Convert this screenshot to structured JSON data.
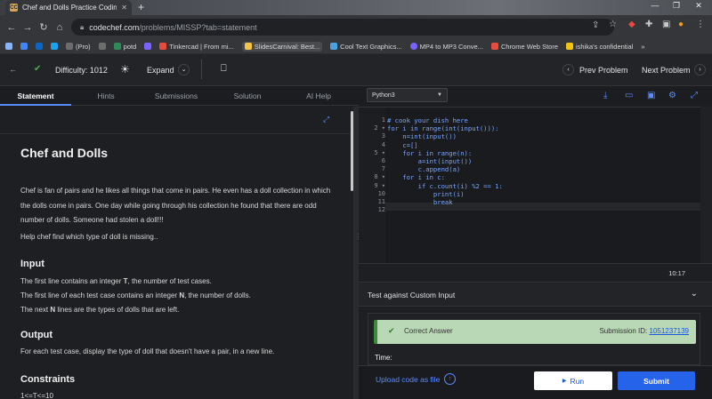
{
  "browser": {
    "tab_title": "Chef and Dolls Practice Coding P",
    "tab_favicon": "CC",
    "url_host": "codechef.com",
    "url_path": "/problems/MISSP?tab=statement",
    "bookmarks": [
      {
        "label": "(Pro)",
        "color": "#6d6d6d"
      },
      {
        "label": "potd",
        "color": "#2e8b57"
      },
      {
        "label": "Tinkercad | From mi...",
        "color": "#e84b3c"
      },
      {
        "label": "SlidesCarnival: Best...",
        "color": "#f4c542"
      },
      {
        "label": "Cool Text Graphics...",
        "color": "#4aa3df"
      },
      {
        "label": "MP4 to MP3 Conve...",
        "color": "#7b61ff"
      },
      {
        "label": "Chrome Web Store",
        "color": "#e74c3c"
      },
      {
        "label": "ishika's confidential",
        "color": "#f1c40f"
      }
    ]
  },
  "header": {
    "difficulty": "Difficulty: 1012",
    "expand": "Expand",
    "prev": "Prev Problem",
    "next": "Next Problem"
  },
  "tabs": [
    "Statement",
    "Hints",
    "Submissions",
    "Solution",
    "AI Help"
  ],
  "statement": {
    "title": "Chef and Dolls",
    "p1": "Chef is fan of pairs and he likes all things that come in pairs. He even has a doll collection in which the dolls come in pairs. One day while going through his collection he found that there are odd number of dolls. Someone had stolen a doll!!!",
    "p2": "Help chef find which type of doll is missing..",
    "input_h": "Input",
    "input_1a": "The first line contains an integer ",
    "input_1b": "T",
    "input_1c": ", the number of test cases.",
    "input_2a": "The first line of each test case contains an integer ",
    "input_2b": "N",
    "input_2c": ", the number of dolls.",
    "input_3a": "The next ",
    "input_3b": "N",
    "input_3c": " lines are the types of dolls that are left.",
    "output_h": "Output",
    "output_p": "For each test case, display the type of doll that doesn't have a pair, in a new line.",
    "constraints_h": "Constraints",
    "constraints_p": "1<=T<=10"
  },
  "editor": {
    "language": "Python3",
    "lines": [
      "# cook your dish here",
      "for i in range(int(input())):",
      "    n=int(input())",
      "    c=[]",
      "    for i in range(n):",
      "        a=int(input())",
      "        c.append(a)",
      "    for i in c:",
      "        if c.count(i) %2 == 1:",
      "            print(i)",
      "            break",
      ""
    ],
    "gutter": [
      "1",
      "2 ▾",
      "3",
      "4",
      "5 ▾",
      "6",
      "7",
      "8 ▾",
      "9 ▾",
      "10",
      "11",
      "12"
    ],
    "time": "10:17"
  },
  "custom_input": "Test against Custom Input",
  "result": {
    "status": "Correct Answer",
    "submission_label": "Submission ID: ",
    "submission_id": "1051237139",
    "time_label": "Time:"
  },
  "actions": {
    "upload": "Upload code as file",
    "run": "Run",
    "submit": "Submit"
  }
}
